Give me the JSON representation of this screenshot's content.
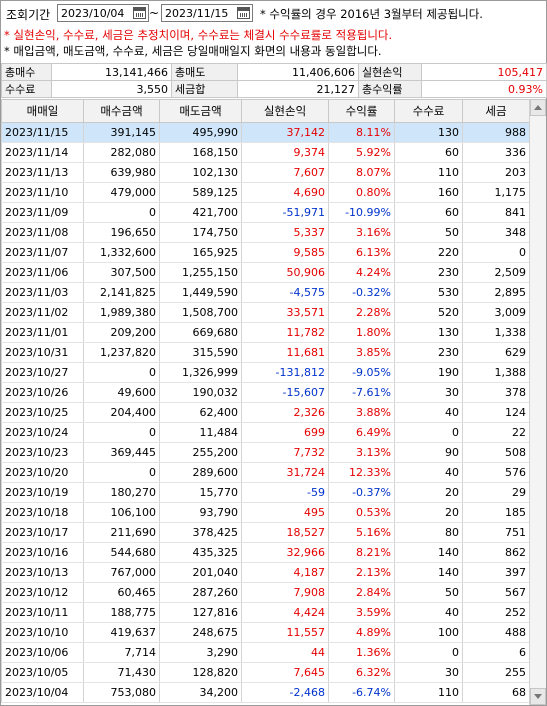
{
  "filter": {
    "period_label": "조회기간",
    "start_date": "2023/10/04",
    "end_date": "2023/11/15",
    "separator": "~"
  },
  "notices": {
    "line1": "* 수익률의 경우 2016년 3월부터 제공됩니다.",
    "line2": "* 실현손익, 수수료, 세금은 추정치이며, 수수료는 체결시 수수료률로 적용됩니다.",
    "line3": "* 매입금액, 매도금액, 수수료, 세금은 당일매매일지 화면의 내용과 동일합니다."
  },
  "summary": {
    "total_buy_label": "총매수",
    "total_buy": "13,141,466",
    "total_sell_label": "총매도",
    "total_sell": "11,406,606",
    "realized_label": "실현손익",
    "realized": "105,417",
    "fee_label": "수수료",
    "fee": "3,550",
    "tax_label": "세금합",
    "tax": "21,127",
    "return_label": "총수익률",
    "return": "0.93%"
  },
  "columns": [
    "매매일",
    "매수금액",
    "매도금액",
    "실현손익",
    "수익률",
    "수수료",
    "세금"
  ],
  "colors": {
    "positive": "#e60000",
    "negative": "#0033cc",
    "selected_row": "#cfe6fa"
  },
  "rows": [
    {
      "date": "2023/11/15",
      "buy": "391,145",
      "sell": "495,990",
      "pnl": "37,142",
      "rate": "8.11%",
      "fee": "130",
      "tax": "988",
      "sign": "pos"
    },
    {
      "date": "2023/11/14",
      "buy": "282,080",
      "sell": "168,150",
      "pnl": "9,374",
      "rate": "5.92%",
      "fee": "60",
      "tax": "336",
      "sign": "pos"
    },
    {
      "date": "2023/11/13",
      "buy": "639,980",
      "sell": "102,130",
      "pnl": "7,607",
      "rate": "8.07%",
      "fee": "110",
      "tax": "203",
      "sign": "pos"
    },
    {
      "date": "2023/11/10",
      "buy": "479,000",
      "sell": "589,125",
      "pnl": "4,690",
      "rate": "0.80%",
      "fee": "160",
      "tax": "1,175",
      "sign": "pos"
    },
    {
      "date": "2023/11/09",
      "buy": "0",
      "sell": "421,700",
      "pnl": "-51,971",
      "rate": "-10.99%",
      "fee": "60",
      "tax": "841",
      "sign": "neg"
    },
    {
      "date": "2023/11/08",
      "buy": "196,650",
      "sell": "174,750",
      "pnl": "5,337",
      "rate": "3.16%",
      "fee": "50",
      "tax": "348",
      "sign": "pos"
    },
    {
      "date": "2023/11/07",
      "buy": "1,332,600",
      "sell": "165,925",
      "pnl": "9,585",
      "rate": "6.13%",
      "fee": "220",
      "tax": "0",
      "sign": "pos"
    },
    {
      "date": "2023/11/06",
      "buy": "307,500",
      "sell": "1,255,150",
      "pnl": "50,906",
      "rate": "4.24%",
      "fee": "230",
      "tax": "2,509",
      "sign": "pos"
    },
    {
      "date": "2023/11/03",
      "buy": "2,141,825",
      "sell": "1,449,590",
      "pnl": "-4,575",
      "rate": "-0.32%",
      "fee": "530",
      "tax": "2,895",
      "sign": "neg"
    },
    {
      "date": "2023/11/02",
      "buy": "1,989,380",
      "sell": "1,508,700",
      "pnl": "33,571",
      "rate": "2.28%",
      "fee": "520",
      "tax": "3,009",
      "sign": "pos"
    },
    {
      "date": "2023/11/01",
      "buy": "209,200",
      "sell": "669,680",
      "pnl": "11,782",
      "rate": "1.80%",
      "fee": "130",
      "tax": "1,338",
      "sign": "pos"
    },
    {
      "date": "2023/10/31",
      "buy": "1,237,820",
      "sell": "315,590",
      "pnl": "11,681",
      "rate": "3.85%",
      "fee": "230",
      "tax": "629",
      "sign": "pos"
    },
    {
      "date": "2023/10/27",
      "buy": "0",
      "sell": "1,326,999",
      "pnl": "-131,812",
      "rate": "-9.05%",
      "fee": "190",
      "tax": "1,388",
      "sign": "neg"
    },
    {
      "date": "2023/10/26",
      "buy": "49,600",
      "sell": "190,032",
      "pnl": "-15,607",
      "rate": "-7.61%",
      "fee": "30",
      "tax": "378",
      "sign": "neg"
    },
    {
      "date": "2023/10/25",
      "buy": "204,400",
      "sell": "62,400",
      "pnl": "2,326",
      "rate": "3.88%",
      "fee": "40",
      "tax": "124",
      "sign": "pos"
    },
    {
      "date": "2023/10/24",
      "buy": "0",
      "sell": "11,484",
      "pnl": "699",
      "rate": "6.49%",
      "fee": "0",
      "tax": "22",
      "sign": "pos"
    },
    {
      "date": "2023/10/23",
      "buy": "369,445",
      "sell": "255,200",
      "pnl": "7,732",
      "rate": "3.13%",
      "fee": "90",
      "tax": "508",
      "sign": "pos"
    },
    {
      "date": "2023/10/20",
      "buy": "0",
      "sell": "289,600",
      "pnl": "31,724",
      "rate": "12.33%",
      "fee": "40",
      "tax": "576",
      "sign": "pos"
    },
    {
      "date": "2023/10/19",
      "buy": "180,270",
      "sell": "15,770",
      "pnl": "-59",
      "rate": "-0.37%",
      "fee": "20",
      "tax": "29",
      "sign": "neg"
    },
    {
      "date": "2023/10/18",
      "buy": "106,100",
      "sell": "93,790",
      "pnl": "495",
      "rate": "0.53%",
      "fee": "20",
      "tax": "185",
      "sign": "pos"
    },
    {
      "date": "2023/10/17",
      "buy": "211,690",
      "sell": "378,425",
      "pnl": "18,527",
      "rate": "5.16%",
      "fee": "80",
      "tax": "751",
      "sign": "pos"
    },
    {
      "date": "2023/10/16",
      "buy": "544,680",
      "sell": "435,325",
      "pnl": "32,966",
      "rate": "8.21%",
      "fee": "140",
      "tax": "862",
      "sign": "pos"
    },
    {
      "date": "2023/10/13",
      "buy": "767,000",
      "sell": "201,040",
      "pnl": "4,187",
      "rate": "2.13%",
      "fee": "140",
      "tax": "397",
      "sign": "pos"
    },
    {
      "date": "2023/10/12",
      "buy": "60,465",
      "sell": "287,260",
      "pnl": "7,908",
      "rate": "2.84%",
      "fee": "50",
      "tax": "567",
      "sign": "pos"
    },
    {
      "date": "2023/10/11",
      "buy": "188,775",
      "sell": "127,816",
      "pnl": "4,424",
      "rate": "3.59%",
      "fee": "40",
      "tax": "252",
      "sign": "pos"
    },
    {
      "date": "2023/10/10",
      "buy": "419,637",
      "sell": "248,675",
      "pnl": "11,557",
      "rate": "4.89%",
      "fee": "100",
      "tax": "488",
      "sign": "pos"
    },
    {
      "date": "2023/10/06",
      "buy": "7,714",
      "sell": "3,290",
      "pnl": "44",
      "rate": "1.36%",
      "fee": "0",
      "tax": "6",
      "sign": "pos"
    },
    {
      "date": "2023/10/05",
      "buy": "71,430",
      "sell": "128,820",
      "pnl": "7,645",
      "rate": "6.32%",
      "fee": "30",
      "tax": "255",
      "sign": "pos"
    },
    {
      "date": "2023/10/04",
      "buy": "753,080",
      "sell": "34,200",
      "pnl": "-2,468",
      "rate": "-6.74%",
      "fee": "110",
      "tax": "68",
      "sign": "neg"
    }
  ]
}
